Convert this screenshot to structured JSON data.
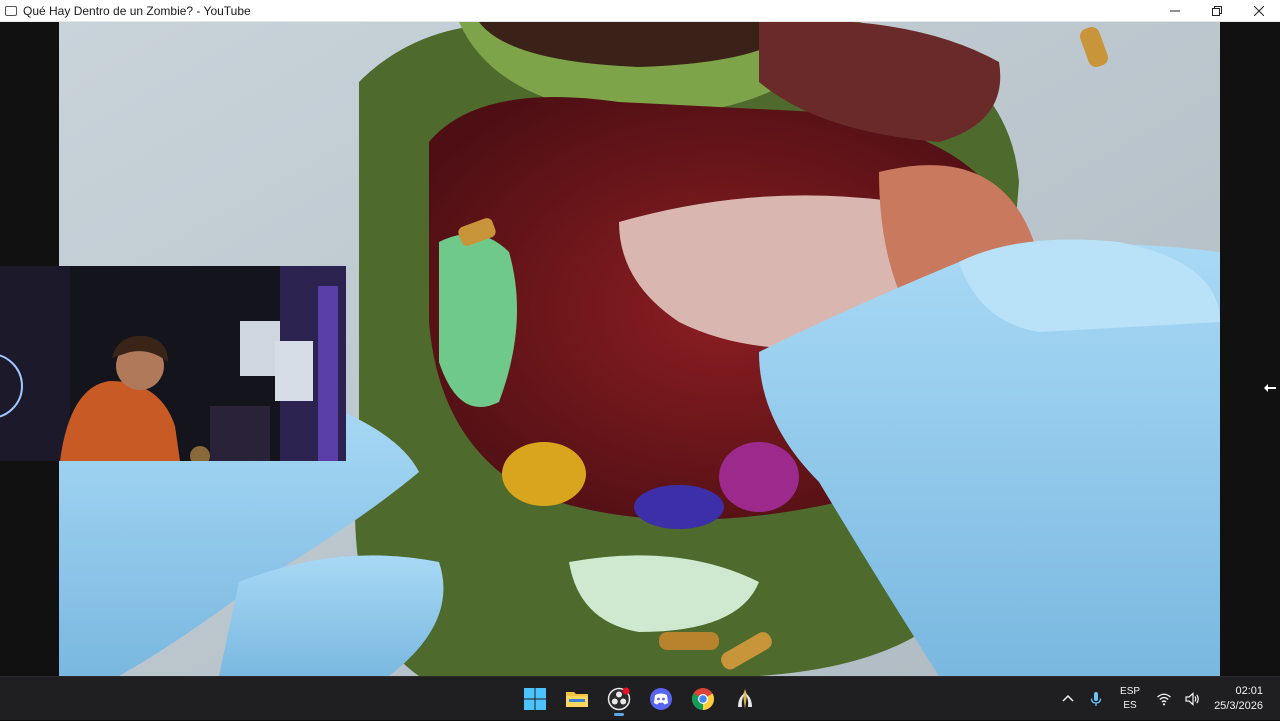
{
  "window": {
    "title": "Qué Hay Dentro de un Zombie? - YouTube",
    "controls": [
      "minimize-icon",
      "restore-icon",
      "close-icon"
    ]
  },
  "video": {
    "content": "video-frame",
    "overlay": "webcam-overlay"
  },
  "taskbar": {
    "apps": [
      {
        "name": "windows-start",
        "icon": "windows-logo-icon"
      },
      {
        "name": "file-explorer",
        "icon": "folder-icon"
      },
      {
        "name": "obs-studio",
        "icon": "obs-icon",
        "active": true,
        "badge_color": "#e81123"
      },
      {
        "name": "discord",
        "icon": "discord-icon"
      },
      {
        "name": "chrome",
        "icon": "chrome-icon"
      },
      {
        "name": "app",
        "icon": "app-icon"
      }
    ],
    "tray": {
      "language_primary": "ESP",
      "language_secondary": "ES",
      "time": "02:01",
      "date": "25/3/2026"
    },
    "accent_color": "#5aa9e6"
  }
}
